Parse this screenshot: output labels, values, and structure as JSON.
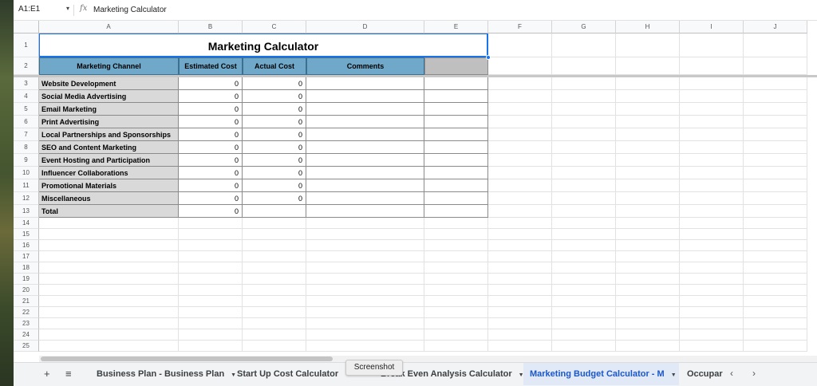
{
  "formula_bar": {
    "name_box": "A1:E1",
    "name_caret": "▾",
    "fx": "fx",
    "value": "Marketing Calculator"
  },
  "columns": [
    "A",
    "B",
    "C",
    "D",
    "E",
    "F",
    "G",
    "H",
    "I",
    "J"
  ],
  "rows": [
    "1",
    "2",
    "3",
    "4",
    "5",
    "6",
    "7",
    "8",
    "9",
    "10",
    "11",
    "12",
    "13",
    "14",
    "15",
    "16",
    "17",
    "18",
    "19",
    "20",
    "21",
    "22",
    "23",
    "24",
    "25"
  ],
  "sheet": {
    "title": "Marketing Calculator",
    "headers": [
      "Marketing Channel",
      "Estimated Cost",
      "Actual Cost",
      "Comments"
    ],
    "channels": [
      {
        "name": "Website Development",
        "estimated": "0",
        "actual": "0"
      },
      {
        "name": "Social Media Advertising",
        "estimated": "0",
        "actual": "0"
      },
      {
        "name": "Email Marketing",
        "estimated": "0",
        "actual": "0"
      },
      {
        "name": "Print Advertising",
        "estimated": "0",
        "actual": "0"
      },
      {
        "name": "Local Partnerships and Sponsorships",
        "estimated": "0",
        "actual": "0"
      },
      {
        "name": "SEO and Content Marketing",
        "estimated": "0",
        "actual": "0"
      },
      {
        "name": "Event Hosting and Participation",
        "estimated": "0",
        "actual": "0"
      },
      {
        "name": "Influencer Collaborations",
        "estimated": "0",
        "actual": "0"
      },
      {
        "name": "Promotional Materials",
        "estimated": "0",
        "actual": "0"
      },
      {
        "name": "Miscellaneous",
        "estimated": "0",
        "actual": "0"
      }
    ],
    "total": {
      "name": "Total",
      "estimated": "0"
    }
  },
  "tabs": {
    "add": "+",
    "menu": "≡",
    "items": [
      {
        "label": "Business Plan - Business Plan"
      },
      {
        "label": "Start Up Cost Calculator"
      },
      {
        "label": "Break Even Analysis Calculator"
      },
      {
        "label": "Marketing Budget Calculator - M"
      },
      {
        "label": "Occupar"
      }
    ],
    "tab_arrow": "▼",
    "prev": "‹",
    "next": "›",
    "tooltip": "Screenshot"
  },
  "colors": {
    "header_fill": "#6fa8c9",
    "channel_fill": "#d9d9d9",
    "active_tab": "#1b57c8"
  }
}
